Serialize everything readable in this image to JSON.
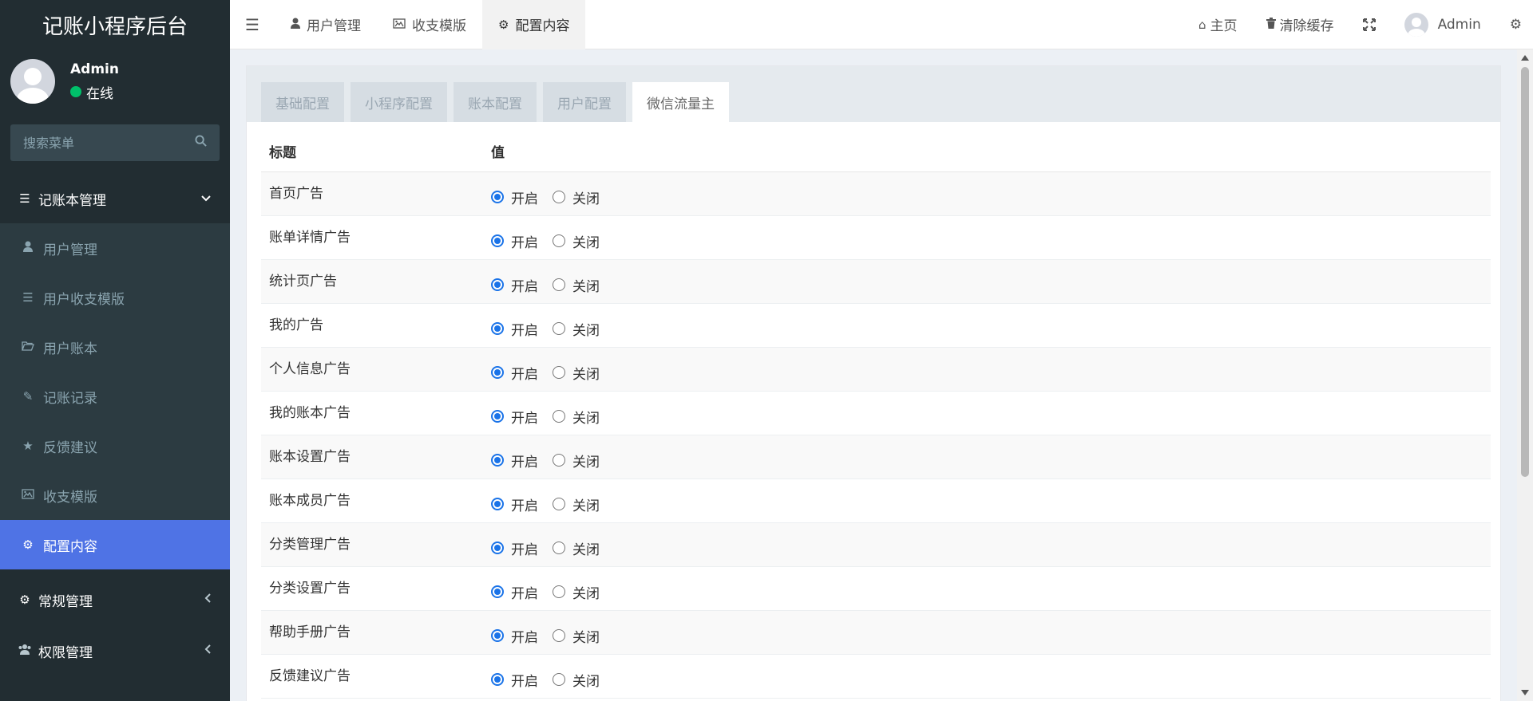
{
  "app": {
    "title": "记账小程序后台"
  },
  "user": {
    "name": "Admin",
    "status": "在线"
  },
  "search": {
    "placeholder": "搜索菜单"
  },
  "sidebar": {
    "group1": {
      "label": "记账本管理",
      "items": [
        {
          "label": "用户管理",
          "icon": "user-icon"
        },
        {
          "label": "用户收支模版",
          "icon": "list-icon"
        },
        {
          "label": "用户账本",
          "icon": "folder-open-icon"
        },
        {
          "label": "记账记录",
          "icon": "pencil-icon"
        },
        {
          "label": "反馈建议",
          "icon": "star-icon"
        },
        {
          "label": "收支模版",
          "icon": "image-icon"
        },
        {
          "label": "配置内容",
          "icon": "gear-icon",
          "active": true
        }
      ]
    },
    "group2": {
      "label": "常规管理"
    },
    "group3": {
      "label": "权限管理"
    }
  },
  "navbar": {
    "tabs": [
      {
        "label": "用户管理"
      },
      {
        "label": "收支模版"
      },
      {
        "label": "配置内容",
        "active": true
      }
    ],
    "home": "主页",
    "clear_cache": "清除缓存",
    "admin": "Admin"
  },
  "config_tabs": [
    "基础配置",
    "小程序配置",
    "账本配置",
    "用户配置",
    "微信流量主"
  ],
  "table": {
    "headers": {
      "title": "标题",
      "value": "值"
    },
    "on_label": "开启",
    "off_label": "关闭",
    "rows": [
      {
        "title": "首页广告",
        "value": "on"
      },
      {
        "title": "账单详情广告",
        "value": "on"
      },
      {
        "title": "统计页广告",
        "value": "on"
      },
      {
        "title": "我的广告",
        "value": "on"
      },
      {
        "title": "个人信息广告",
        "value": "on"
      },
      {
        "title": "我的账本广告",
        "value": "on"
      },
      {
        "title": "账本设置广告",
        "value": "on"
      },
      {
        "title": "账本成员广告",
        "value": "on"
      },
      {
        "title": "分类管理广告",
        "value": "on"
      },
      {
        "title": "分类设置广告",
        "value": "on"
      },
      {
        "title": "帮助手册广告",
        "value": "on"
      },
      {
        "title": "反馈建议广告",
        "value": "on"
      }
    ]
  },
  "colors": {
    "sidebar_bg": "#222d32",
    "active_item": "#4f73e5",
    "online": "#00c06a",
    "radio": "#1a73e8"
  }
}
